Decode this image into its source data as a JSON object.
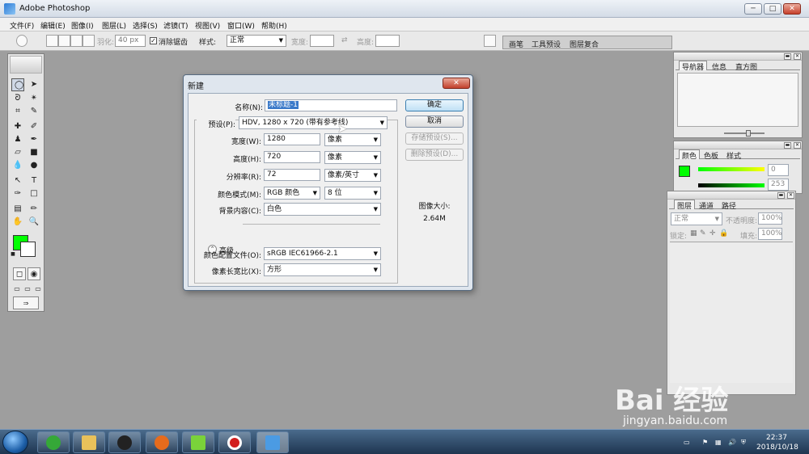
{
  "window": {
    "title": "Adobe Photoshop",
    "min": "─",
    "max": "□",
    "close": "✕"
  },
  "menu": [
    "文件(F)",
    "编辑(E)",
    "图像(I)",
    "图层(L)",
    "选择(S)",
    "滤镜(T)",
    "视图(V)",
    "窗口(W)",
    "帮助(H)"
  ],
  "options": {
    "feather_label": "羽化:",
    "feather_value": "40 px",
    "antialias_label": "消除锯齿",
    "style_label": "样式:",
    "style_value": "正常",
    "width_label": "宽度:",
    "height_label": "高度:",
    "tabs": [
      "画笔",
      "工具预设",
      "图层复合"
    ]
  },
  "dialog": {
    "title": "新建",
    "name_label": "名称(N):",
    "name_value": "未标题-1",
    "preset_label": "预设(P):",
    "preset_value": "HDV, 1280 x 720 (带有参考线)",
    "width_label": "宽度(W):",
    "width_value": "1280",
    "width_unit": "像素",
    "height_label": "高度(H):",
    "height_value": "720",
    "height_unit": "像素",
    "res_label": "分辨率(R):",
    "res_value": "72",
    "res_unit": "像素/英寸",
    "mode_label": "颜色模式(M):",
    "mode_value": "RGB 颜色",
    "mode_bits": "8 位",
    "bg_label": "背景内容(C):",
    "bg_value": "白色",
    "advanced_label": "高级",
    "profile_label": "颜色配置文件(O):",
    "profile_value": "sRGB IEC61966-2.1",
    "aspect_label": "像素长宽比(X):",
    "aspect_value": "方形",
    "ok": "确定",
    "cancel": "取消",
    "save_preset": "存储预设(S)...",
    "delete_preset": "删除预设(D)...",
    "size_label": "图像大小:",
    "size_value": "2.64M",
    "close": "✕"
  },
  "panels": {
    "nav_tabs": [
      "导航器",
      "信息",
      "直方图"
    ],
    "color_tabs": [
      "颜色",
      "色板",
      "样式"
    ],
    "color_r": "0",
    "color_g": "253",
    "layer_tabs": [
      "图层",
      "通道",
      "路径"
    ],
    "blend_mode": "正常",
    "opacity_label": "不透明度:",
    "opacity_value": "100%",
    "lock_label": "锁定:",
    "fill_label": "填充:",
    "fill_value": "100%"
  },
  "colors": {
    "foreground": "#00ff00",
    "background": "#ffffff"
  },
  "taskbar": {
    "time": "22:37",
    "date": "2018/10/18"
  },
  "watermark": {
    "main": "Bai 经验",
    "sub": "jingyan.baidu.com"
  }
}
